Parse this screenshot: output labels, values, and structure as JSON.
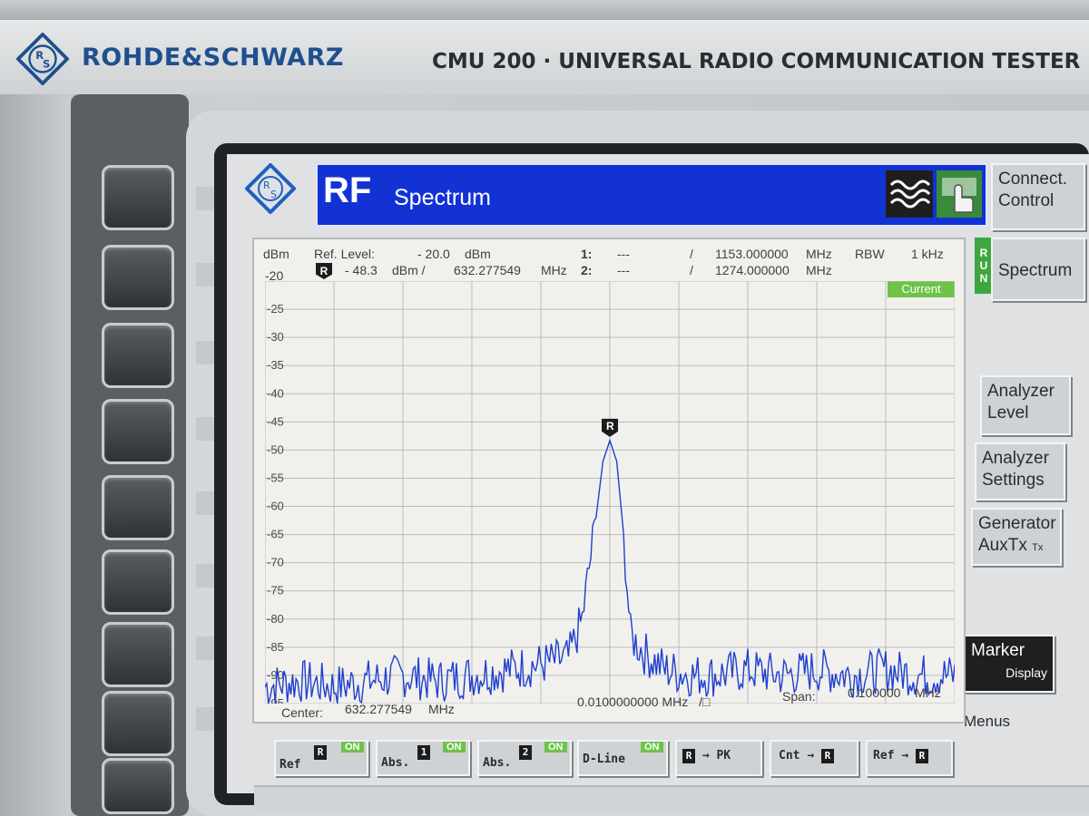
{
  "device": {
    "brand": "ROHDE&SCHWARZ",
    "model": "CMU 200 · UNIVERSAL RADIO COMMUNICATION TESTER"
  },
  "screen": {
    "title": {
      "big": "RF",
      "sub": "Spectrum"
    },
    "header": {
      "unit": "dBm",
      "ref_label": "Ref. Level:",
      "ref_value": "- 20.0",
      "ref_unit": "dBm",
      "top_value": "-20",
      "marker_r_value": "- 48.3",
      "marker_r_unit": "dBm /",
      "marker_r_freq": "632.277549",
      "marker_r_freq_unit": "MHz",
      "m1_label": "1:",
      "m1_value": "---",
      "m1_sep": "/",
      "m1_freq": "1153.000000",
      "m1_freq_unit": "MHz",
      "m2_label": "2:",
      "m2_value": "---",
      "m2_sep": "/",
      "m2_freq": "1274.000000",
      "m2_freq_unit": "MHz",
      "rbw_label": "RBW",
      "rbw_value": "1 kHz"
    },
    "status_badge": "Current",
    "y_ticks": [
      "-25",
      "-30",
      "-35",
      "-40",
      "-45",
      "-50",
      "-55",
      "-60",
      "-65",
      "-70",
      "-75",
      "-80",
      "-85",
      "-90",
      "-95"
    ],
    "footer": {
      "center_label": "Center:",
      "center_value": "632.277549",
      "center_unit": "MHz",
      "div_value": "0.0100000000 MHz",
      "div_unit": "/□",
      "span_label": "Span:",
      "span_value": "0.100000",
      "span_unit": "MHz"
    },
    "side_buttons": {
      "connect_control": "Connect. Control",
      "run_vertical": "RUN",
      "spectrum": "Spectrum",
      "analyzer_level_1": "Analyzer",
      "analyzer_level_2": "Level",
      "analyzer_settings_1": "Analyzer",
      "analyzer_settings_2": "Settings",
      "generator_1": "Generator",
      "generator_2": "AuxTx",
      "generator_sub": "Tx",
      "marker_1": "Marker",
      "marker_2": "Display",
      "menus": "Menus"
    },
    "bottom_buttons": {
      "ref": "Ref",
      "ref_on": "ON",
      "abs1": "Abs.",
      "abs1_num": "1",
      "abs1_on": "ON",
      "abs2": "Abs.",
      "abs2_num": "2",
      "abs2_on": "ON",
      "dline": "D-Line",
      "dline_on": "ON",
      "r_to_pk": "→ PK",
      "cnt_to_r_1": "Cnt",
      "cnt_to_r_2": "→",
      "ref_to_r_1": "Ref",
      "ref_to_r_2": "→"
    },
    "marker_r_symbol": "R"
  },
  "chart_data": {
    "type": "line",
    "xlabel": "",
    "ylabel": "dBm",
    "ylim": [
      -95,
      -20
    ],
    "xlim_offset_khz": [
      -50,
      50
    ],
    "peak": {
      "x_offset_khz": 0,
      "y": -48.3,
      "label": "R"
    },
    "series": [
      {
        "values_desc": "",
        "x_offset_khz": [
          -50,
          -45,
          -40,
          -35,
          -30,
          -25,
          -20,
          -15,
          -10,
          -6,
          -4,
          -2,
          -1,
          0,
          1,
          2,
          3,
          5,
          8,
          12,
          15,
          20,
          25,
          30,
          35,
          40,
          45,
          50
        ],
        "y": [
          -92,
          -91,
          -92,
          -91,
          -90,
          -91,
          -90,
          -89,
          -88,
          -87,
          -80,
          -62,
          -52,
          -48.3,
          -52,
          -65,
          -83,
          -86,
          -89,
          -90,
          -90,
          -89,
          -90,
          -89,
          -90,
          -89,
          -90,
          -90
        ]
      }
    ]
  }
}
